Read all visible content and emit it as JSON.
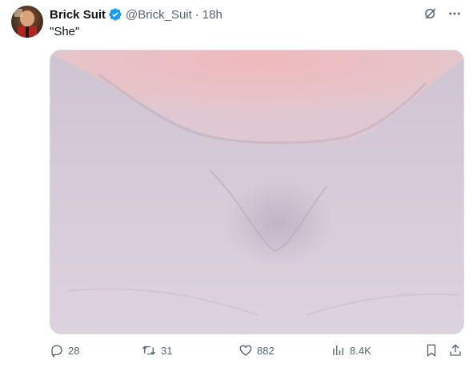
{
  "author": {
    "display_name": "Brick Suit",
    "handle": "@Brick_Suit",
    "separator": "·",
    "time": "18h"
  },
  "tweet": {
    "text": "\"She\""
  },
  "media": {
    "description_icon": "image-photo"
  },
  "actions": {
    "replies": "28",
    "retweets": "31",
    "likes": "882",
    "views": "8.4K"
  },
  "colors": {
    "text_primary": "#0f1419",
    "text_secondary": "#536471",
    "verified_blue": "#1d9bf0",
    "border": "#cfd9de"
  },
  "icons": {
    "verified": "verified-badge-icon",
    "grok": "grok-icon",
    "more": "more-icon",
    "reply": "reply-icon",
    "retweet": "retweet-icon",
    "like": "heart-icon",
    "views": "views-icon",
    "bookmark": "bookmark-icon",
    "share": "share-icon"
  }
}
